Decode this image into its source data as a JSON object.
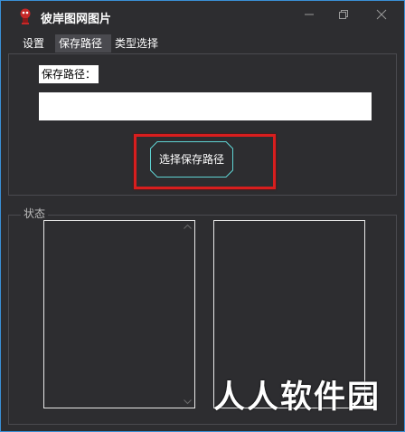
{
  "window": {
    "title": "彼岸图网图片"
  },
  "menu": {
    "items": [
      {
        "label": "设置",
        "active": false
      },
      {
        "label": "保存路径",
        "active": true
      },
      {
        "label": "类型选择",
        "active": false
      }
    ]
  },
  "save_path": {
    "label": "保存路径：",
    "value": "",
    "button_label": "选择保存路径"
  },
  "status": {
    "legend": "状态"
  },
  "watermark": {
    "text": "人人软件园"
  },
  "colors": {
    "background": "#2d2d30",
    "window_border": "#3a8fd6",
    "highlight": "#d81e1e",
    "button_border": "#5fd3d3"
  }
}
